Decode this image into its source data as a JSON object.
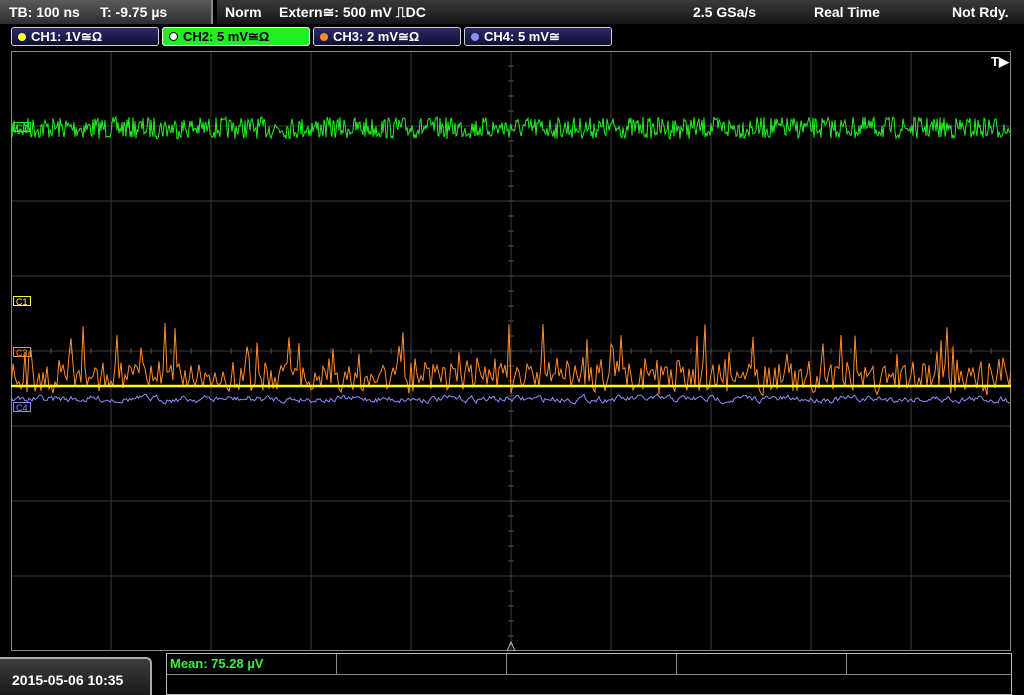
{
  "status": {
    "timebase": "TB: 100 ns",
    "trigger_time": "T: -9.75 µs",
    "mode": "Norm",
    "trigger_source": "Extern≅: 500 mV ⎍DC",
    "sample_rate": "2.5 GSa/s",
    "acq_mode": "Real Time",
    "ready_state": "Not Rdy."
  },
  "channels": [
    {
      "label": "CH1: 1V≅Ω",
      "color": "#ffff33"
    },
    {
      "label": "CH2: 5 mV≅Ω",
      "color": "#22ee22"
    },
    {
      "label": "CH3: 2 mV≅Ω",
      "color": "#ff8c2a"
    },
    {
      "label": "CH4: 5 mV≅",
      "color": "#8c8cff"
    }
  ],
  "markers": {
    "c2": "C2",
    "c1": "C1",
    "c3": "C3",
    "c4": "C4",
    "trigger": "T▶"
  },
  "footer": {
    "datetime": "2015-05-06 10:35",
    "measurement": "Mean: 75.28 µV"
  }
}
